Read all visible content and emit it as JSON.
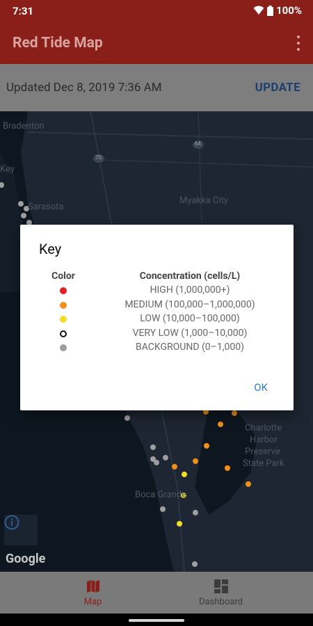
{
  "status_bar": {
    "time": "7:31",
    "battery": "100%"
  },
  "app_bar": {
    "title": "Red Tide Map"
  },
  "update_bar": {
    "text": "Updated Dec 8, 2019 7:36 AM",
    "button": "UPDATE"
  },
  "map": {
    "labels": {
      "bradenton": "Bradenton",
      "key": "Key",
      "sarasota": "Sarasota",
      "myakka": "Myakka City",
      "charlotte1": "Charlotte",
      "charlotte2": "Harbor",
      "charlotte3": "Preserve",
      "charlotte4": "State Park",
      "boca": "Boca Grande",
      "road64": "64",
      "road70": "70"
    },
    "attribution": "Google"
  },
  "dialog": {
    "title": "Key",
    "col_color": "Color",
    "col_concentration": "Concentration (cells/L)",
    "rows": [
      {
        "label": "HIGH (1,000,000+)",
        "color": "#e62020"
      },
      {
        "label": "MEDIUM (100,000–1,000,000)",
        "color": "#f0901a"
      },
      {
        "label": "LOW (10,000–100,000)",
        "color": "#f2dc2a"
      },
      {
        "label": "VERY LOW (1,000–10,000)",
        "color": "#ffffff"
      },
      {
        "label": "BACKGROUND (0–1,000)",
        "color": "#9e9e9e"
      }
    ],
    "ok": "OK"
  },
  "bottom_nav": {
    "map": "Map",
    "dashboard": "Dashboard"
  },
  "colors": {
    "primary": "#8a1f1a",
    "accent": "#2f78d6"
  }
}
